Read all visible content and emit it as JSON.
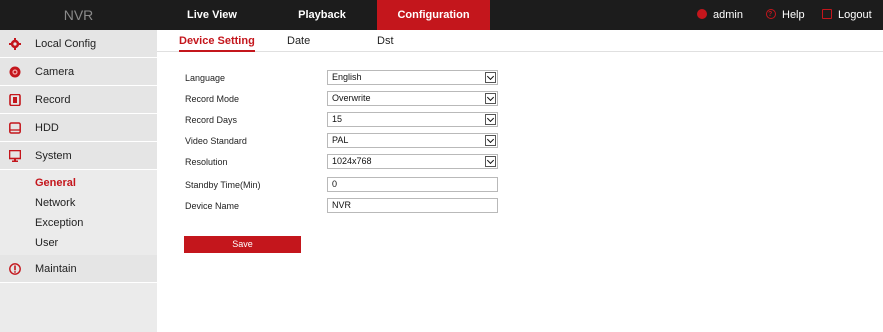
{
  "logo": "NVR",
  "nav": {
    "tabs": [
      {
        "label": "Live View"
      },
      {
        "label": "Playback"
      },
      {
        "label": "Configuration",
        "active": true
      }
    ],
    "right": {
      "admin": "admin",
      "help": "Help",
      "logout": "Logout"
    }
  },
  "sidebar": {
    "items": [
      {
        "label": "Local Config",
        "icon": "gear-icon"
      },
      {
        "label": "Camera",
        "icon": "camera-icon"
      },
      {
        "label": "Record",
        "icon": "record-icon"
      },
      {
        "label": "HDD",
        "icon": "hdd-icon"
      },
      {
        "label": "System",
        "icon": "monitor-icon"
      },
      {
        "label": "Maintain",
        "icon": "info-icon"
      }
    ],
    "system_sub": [
      {
        "label": "General",
        "active": true
      },
      {
        "label": "Network"
      },
      {
        "label": "Exception"
      },
      {
        "label": "User"
      }
    ]
  },
  "subtabs": [
    {
      "label": "Device Setting",
      "active": true
    },
    {
      "label": "Date"
    },
    {
      "label": "Dst"
    }
  ],
  "form": {
    "language": {
      "label": "Language",
      "value": "English"
    },
    "record_mode": {
      "label": "Record Mode",
      "value": "Overwrite"
    },
    "record_days": {
      "label": "Record Days",
      "value": "15"
    },
    "video_standard": {
      "label": "Video Standard",
      "value": "PAL"
    },
    "resolution": {
      "label": "Resolution",
      "value": "1024x768"
    },
    "standby_time": {
      "label": "Standby Time(Min)",
      "value": "0"
    },
    "device_name": {
      "label": "Device Name",
      "value": "NVR"
    }
  },
  "save_label": "Save",
  "colors": {
    "accent": "#c4161c",
    "topbar": "#1c1c1c",
    "sidebar": "#e5e5e5"
  }
}
